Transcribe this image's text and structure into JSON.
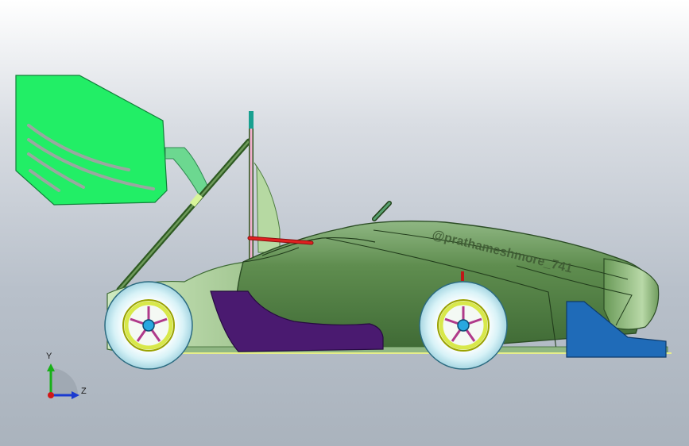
{
  "model": {
    "watermark_text": "@prathameshmore_741"
  },
  "triad": {
    "y_label": "Y",
    "z_label": "Z"
  },
  "colors": {
    "background_top": "#ffffff",
    "background_bottom": "#aab3bd",
    "body_green": "#5f8d4f",
    "wing_green": "#22ee66",
    "sidepod_purple": "#4a1a70",
    "front_wing_blue": "#1f6bb8",
    "tire_cyan": "#cfeef5",
    "rim_yellow": "#d8e84a",
    "strut_red": "#d01a1a"
  },
  "icons": {
    "axis_triad": "axis-triad-icon"
  }
}
